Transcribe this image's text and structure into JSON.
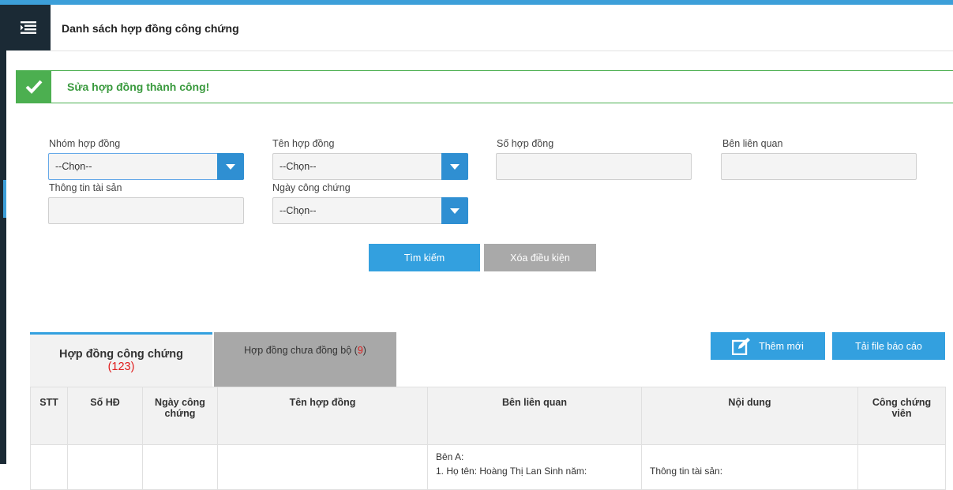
{
  "header": {
    "title": "Danh sách hợp đồng công chứng"
  },
  "alert": {
    "message": "Sửa hợp đồng thành công!"
  },
  "filters": {
    "contract_group": {
      "label": "Nhóm hợp đồng",
      "value": "--Chọn--"
    },
    "contract_name": {
      "label": "Tên hợp đồng",
      "value": "--Chọn--"
    },
    "contract_number": {
      "label": "Số hợp đồng",
      "value": ""
    },
    "related_party": {
      "label": "Bên liên quan",
      "value": ""
    },
    "asset_info": {
      "label": "Thông tin tài sản",
      "value": ""
    },
    "notary_date": {
      "label": "Ngày công chứng",
      "value": "--Chọn--"
    }
  },
  "actions": {
    "search": "Tìm kiếm",
    "clear": "Xóa điều kiện",
    "add_new": "Thêm mới",
    "download_report": "Tải file báo cáo"
  },
  "tabs": [
    {
      "label": "Hợp đồng công chứng",
      "count": "(123)"
    },
    {
      "label": "Hợp đồng chưa đồng bộ",
      "count": "9"
    }
  ],
  "table": {
    "columns": [
      "STT",
      "Số HĐ",
      "Ngày công chứng",
      "Tên hợp đồng",
      "Bên liên quan",
      "Nội dung",
      "Công chứng viên"
    ],
    "rows": [
      {
        "stt": "",
        "number": "",
        "date": "",
        "name": "",
        "party": "Bên A:",
        "party_detail": "1. Họ tên: Hoàng Thị Lan Sinh năm:",
        "content": "Thông tin tài sản:",
        "notary": ""
      }
    ]
  },
  "colors": {
    "accent": "#33a0df",
    "success": "#4caf50",
    "sidebar": "#1b2a35",
    "count_red": "#e01b1b"
  }
}
